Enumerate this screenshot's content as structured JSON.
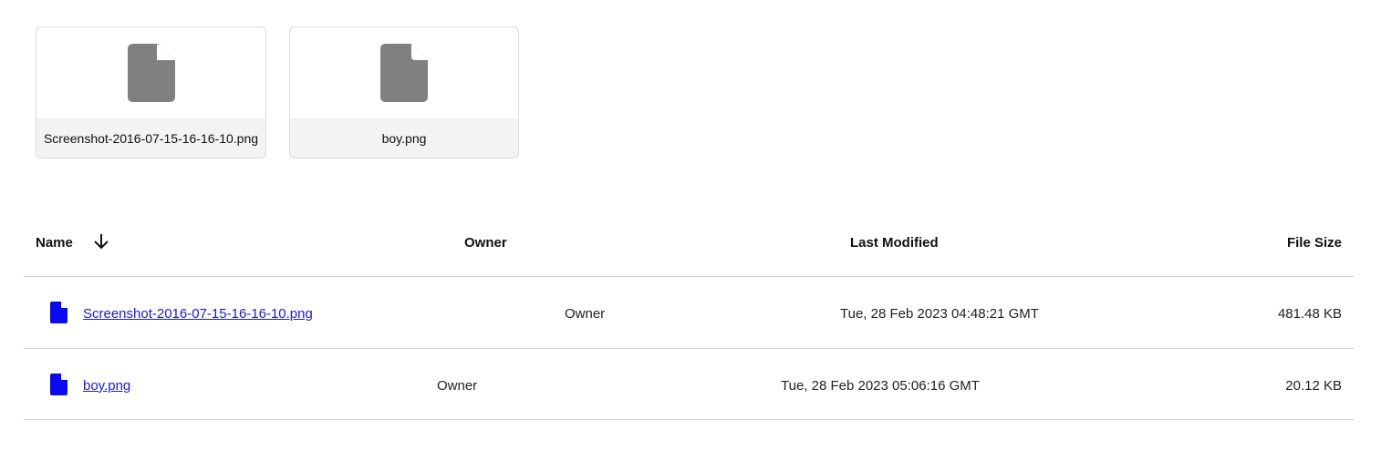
{
  "cards": [
    {
      "filename": "Screenshot-2016-07-15-16-16-10.png",
      "icon": "file-icon"
    },
    {
      "filename": "boy.png",
      "icon": "file-icon"
    }
  ],
  "table": {
    "headers": {
      "name": "Name",
      "owner": "Owner",
      "last_modified": "Last Modified",
      "file_size": "File Size"
    },
    "sort_icon": "arrow-down-icon",
    "rows": [
      {
        "name": "Screenshot-2016-07-15-16-16-10.png",
        "owner": "Owner",
        "last_modified": "Tue, 28 Feb 2023 04:48:21 GMT",
        "file_size": "481.48 KB"
      },
      {
        "name": "boy.png",
        "owner": "Owner",
        "last_modified": "Tue, 28 Feb 2023 05:06:16 GMT",
        "file_size": "20.12 KB"
      }
    ]
  },
  "colors": {
    "link": "#1a1ad6",
    "row_icon": "#0a0af0",
    "card_icon": "#808080",
    "caption_bg": "#f3f3f3",
    "divider": "#cfcfcf"
  }
}
